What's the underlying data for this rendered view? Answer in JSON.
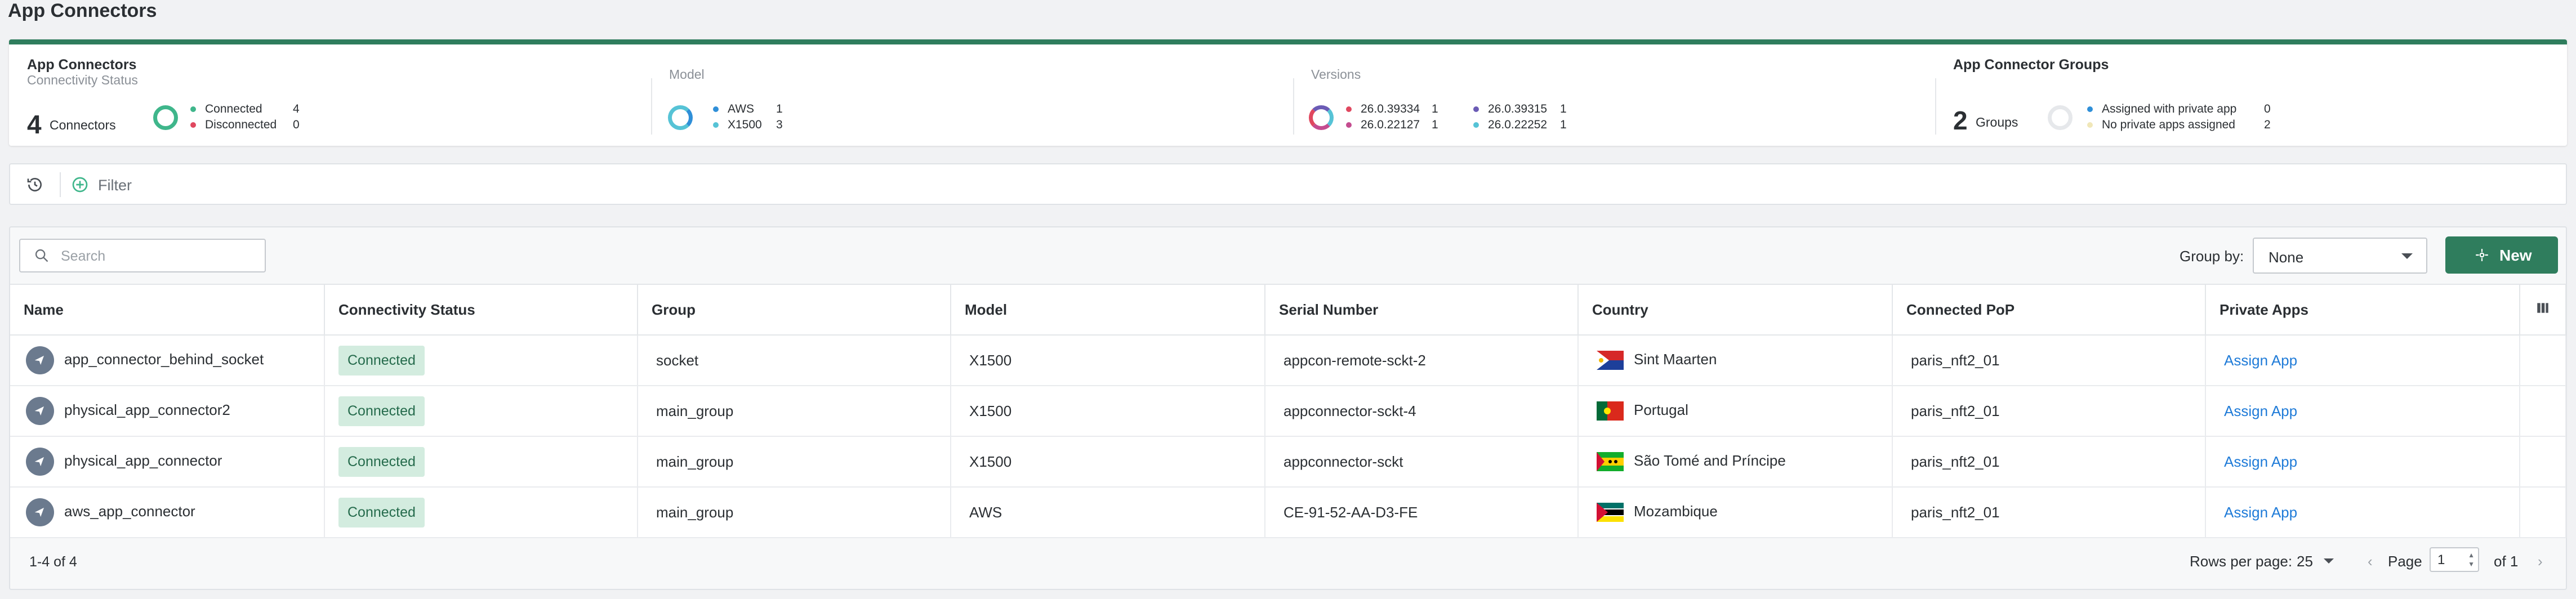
{
  "page": {
    "title": "App Connectors"
  },
  "summary": {
    "connectors": {
      "heading": "App Connectors",
      "subheading": "Connectivity Status",
      "count": "4",
      "count_label": "Connectors",
      "legend": [
        {
          "label": "Connected",
          "value": "4",
          "color": "#3fb68b"
        },
        {
          "label": "Disconnected",
          "value": "0",
          "color": "#e0475f"
        }
      ]
    },
    "model": {
      "heading": "Model",
      "legend": [
        {
          "label": "AWS",
          "value": "1",
          "color": "#2f8fd8"
        },
        {
          "label": "X1500",
          "value": "3",
          "color": "#56c3d6"
        }
      ]
    },
    "versions": {
      "heading": "Versions",
      "legend": [
        {
          "label": "26.0.39334",
          "value": "1",
          "color": "#e0475f"
        },
        {
          "label": "26.0.22127",
          "value": "1",
          "color": "#c44c8f"
        },
        {
          "label": "26.0.39315",
          "value": "1",
          "color": "#6b5bb5"
        },
        {
          "label": "26.0.22252",
          "value": "1",
          "color": "#56c3d6"
        }
      ]
    },
    "groups": {
      "heading": "App Connector Groups",
      "count": "2",
      "count_label": "Groups",
      "legend": [
        {
          "label": "Assigned with private app",
          "value": "0",
          "color": "#2f8fd8"
        },
        {
          "label": "No private apps assigned",
          "value": "2",
          "color": "#f0e7b8"
        }
      ]
    }
  },
  "filterbar": {
    "filter_label": "Filter"
  },
  "toolbar": {
    "search_placeholder": "Search",
    "group_by_label": "Group by:",
    "group_by_value": "None",
    "new_label": "New"
  },
  "table": {
    "columns": [
      "Name",
      "Connectivity Status",
      "Group",
      "Model",
      "Serial Number",
      "Country",
      "Connected PoP",
      "Private Apps"
    ],
    "rows": [
      {
        "name": "app_connector_behind_socket",
        "status": "Connected",
        "group": "socket",
        "model": "X1500",
        "serial": "appcon-remote-sckt-2",
        "country": "Sint Maarten",
        "pop": "paris_nft2_01",
        "apps": "Assign App"
      },
      {
        "name": "physical_app_connector2",
        "status": "Connected",
        "group": "main_group",
        "model": "X1500",
        "serial": "appconnector-sckt-4",
        "country": "Portugal",
        "pop": "paris_nft2_01",
        "apps": "Assign App"
      },
      {
        "name": "physical_app_connector",
        "status": "Connected",
        "group": "main_group",
        "model": "X1500",
        "serial": "appconnector-sckt",
        "country": "São Tomé and Príncipe",
        "pop": "paris_nft2_01",
        "apps": "Assign App"
      },
      {
        "name": "aws_app_connector",
        "status": "Connected",
        "group": "main_group",
        "model": "AWS",
        "serial": "CE-91-52-AA-D3-FE",
        "country": "Mozambique",
        "pop": "paris_nft2_01",
        "apps": "Assign App"
      }
    ]
  },
  "footer": {
    "count_text": "1-4 of 4",
    "rows_per_page_label": "Rows per page:",
    "rows_per_page_value": "25",
    "page_label": "Page",
    "page_value": "1",
    "of_label": "of 1"
  }
}
